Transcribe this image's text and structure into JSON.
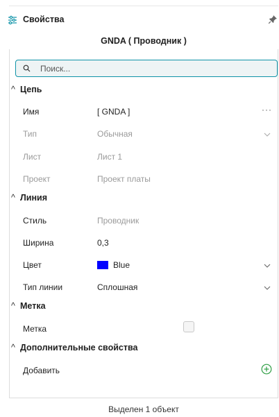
{
  "header": {
    "title": "Свойства",
    "icon": "sliders-icon",
    "pin_icon": "pin-icon"
  },
  "object_title": "GNDA ( Проводник )",
  "search": {
    "placeholder": "Поиск..."
  },
  "sections": {
    "chain": {
      "title": "Цепь",
      "rows": {
        "name": {
          "label": "Имя",
          "value": "[ GNDA ]"
        },
        "type": {
          "label": "Тип",
          "value": "Обычная"
        },
        "sheet": {
          "label": "Лист",
          "value": "Лист 1"
        },
        "project": {
          "label": "Проект",
          "value": "Проект платы"
        }
      }
    },
    "line": {
      "title": "Линия",
      "rows": {
        "style": {
          "label": "Стиль",
          "value": "Проводник"
        },
        "width": {
          "label": "Ширина",
          "value": "0,3"
        },
        "color": {
          "label": "Цвет",
          "value": "Blue",
          "swatch": "#0000ff"
        },
        "line_type": {
          "label": "Тип линии",
          "value": "Сплошная"
        }
      }
    },
    "mark": {
      "title": "Метка",
      "rows": {
        "mark": {
          "label": "Метка"
        }
      }
    },
    "extra": {
      "title": "Дополнительные свойства",
      "rows": {
        "add": {
          "label": "Добавить"
        }
      }
    }
  },
  "footer": "Выделен 1 объект",
  "colors": {
    "accent": "#0e93a8",
    "swatch": "#0000ff"
  }
}
